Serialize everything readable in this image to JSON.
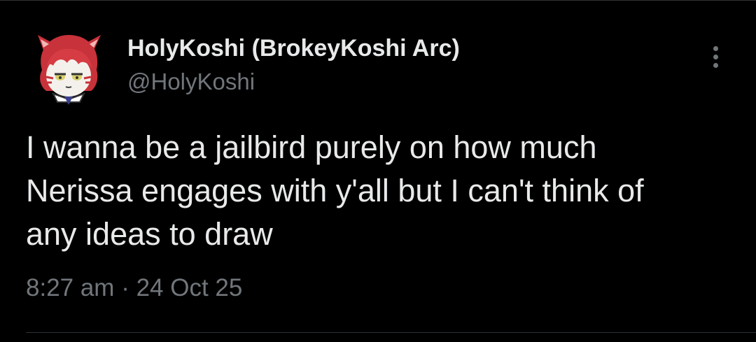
{
  "tweet": {
    "author": {
      "display_name": "HolyKoshi (BrokeyKoshi Arc)",
      "handle": "@HolyKoshi",
      "avatar_icon": "anime-red-hair-avatar-icon"
    },
    "menu_icon": "more-vertical-icon",
    "text_lines": [
      "I wanna be a jailbird purely on how much",
      "Nerissa engages with y'all but I can't think of",
      "any ideas to draw"
    ],
    "time": "8:27 am",
    "separator": "·",
    "date": "24 Oct 25"
  },
  "colors": {
    "background": "#000000",
    "primary_text": "#e7e9ea",
    "secondary_text": "#71767b",
    "divider": "#2f3336"
  }
}
